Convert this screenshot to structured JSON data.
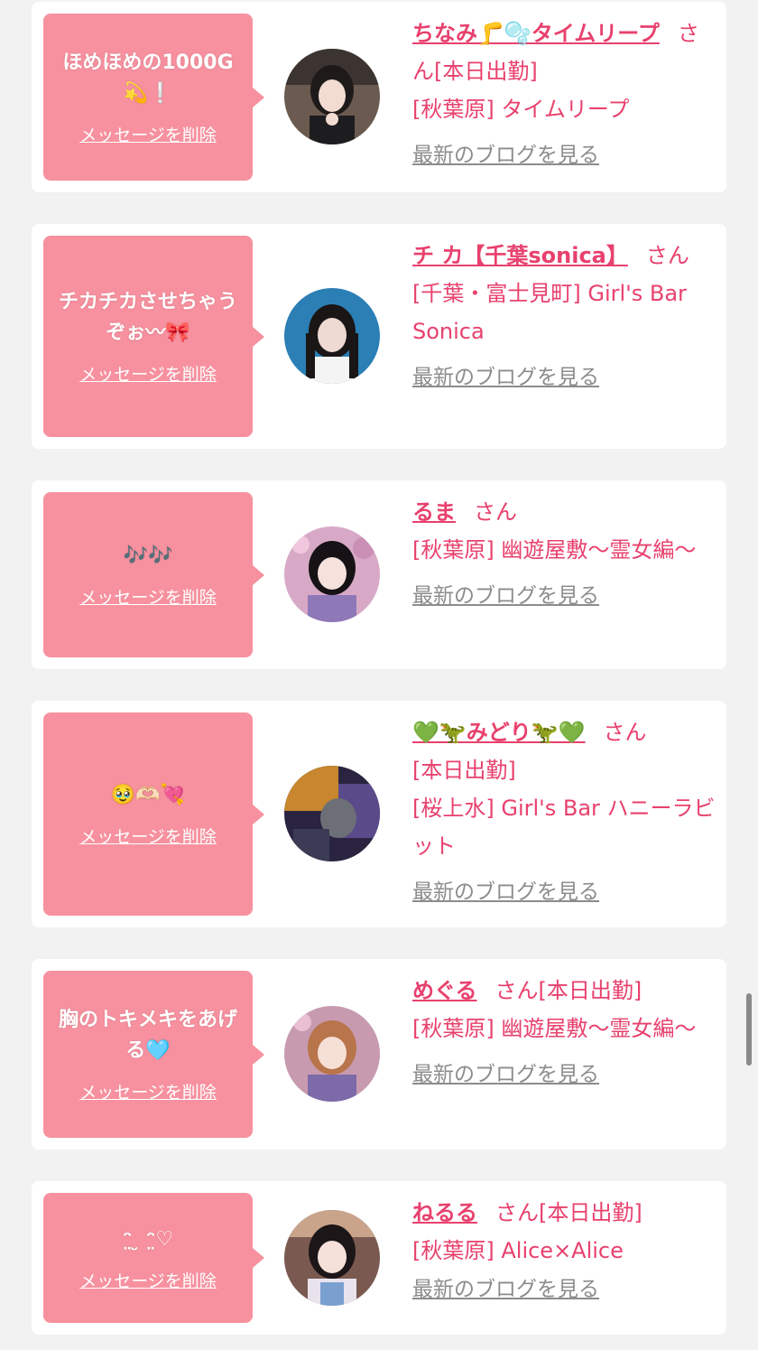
{
  "ui": {
    "delete_label": "メッセージを削除",
    "blog_label": "最新のブログを見る",
    "san_label": "さん"
  },
  "colors": {
    "bubble": "#f7919f",
    "accent": "#e8416d",
    "muted": "#8c8c8c",
    "background": "#f2f2f2"
  },
  "cards": [
    {
      "message": "ほめほめの1000G💫❕",
      "name": "ちなみ🦵🫧タイムリープ",
      "status": "[本日出勤]",
      "shop": "[秋葉原] タイムリープ"
    },
    {
      "message": "チカチカさせちゃうぞぉ〰🎀",
      "name": "チ カ【千葉sonica】",
      "status": "",
      "shop": "[千葉・富士見町] Girl's Bar Sonica"
    },
    {
      "message": "🎶🎶",
      "name": "るま",
      "status": "",
      "shop": "[秋葉原] 幽遊屋敷〜霊女編〜"
    },
    {
      "message": "🥹🫶🏻💘",
      "name": "💚🦖みどり🦖💚",
      "status": "[本日出勤]",
      "shop": "[桜上水] Girl's Bar ハニーラビット"
    },
    {
      "message": "胸のトキメキをあげる🩵",
      "name": "めぐる",
      "status": "[本日出勤]",
      "shop": "[秋葉原] 幽遊屋敷〜霊女編〜"
    },
    {
      "message": "ᵔ̤ ̮ ᵔ̤♡",
      "name": "ねるる",
      "status": "[本日出勤]",
      "shop": "[秋葉原] Alice×Alice"
    }
  ]
}
